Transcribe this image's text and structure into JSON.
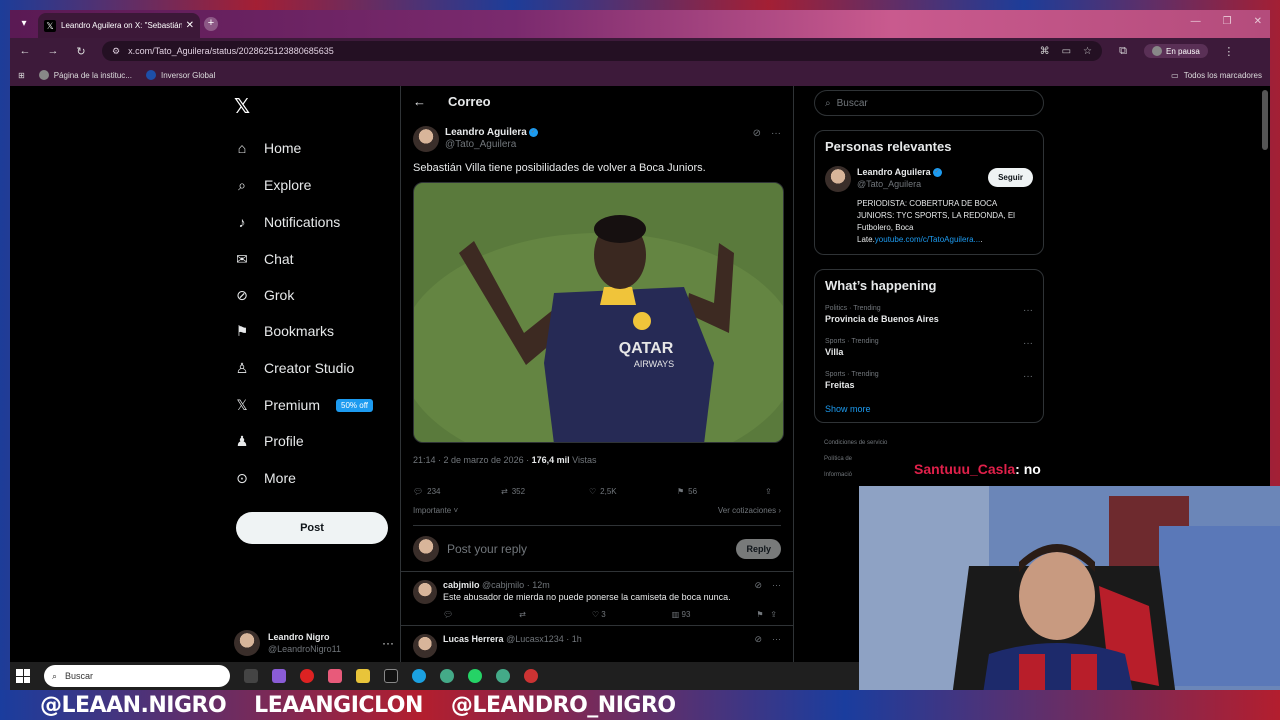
{
  "browser": {
    "tab_title": "Leandro Aguilera on X: \"Sebastián",
    "url": "x.com/Tato_Aguilera/status/2028625123880685635",
    "profile_status": "En pausa",
    "bookmarks": [
      "Página de la instituc...",
      "Inversor Global"
    ],
    "all_bookmarks": "Todos los marcadores"
  },
  "sidebar": {
    "items": [
      {
        "label": "Home"
      },
      {
        "label": "Explore"
      },
      {
        "label": "Notifications"
      },
      {
        "label": "Chat"
      },
      {
        "label": "Grok"
      },
      {
        "label": "Bookmarks"
      },
      {
        "label": "Creator Studio"
      },
      {
        "label": "Premium",
        "badge": "50% off"
      },
      {
        "label": "Profile"
      },
      {
        "label": "More"
      }
    ],
    "post_label": "Post",
    "account": {
      "name": "Leandro Nigro",
      "handle": "@LeandroNigro11"
    }
  },
  "main": {
    "header": "Correo",
    "tweet": {
      "name": "Leandro Aguilera",
      "handle": "@Tato_Aguilera",
      "text": "Sebastián Villa tiene posibilidades de volver a Boca Juniors.",
      "timestamp": "21:14 · 2 de marzo de 2026 ·",
      "views": "176,4 mil",
      "views_label": "Vistas",
      "replies": "234",
      "reposts": "352",
      "likes": "2,5K",
      "bookmarks": "56",
      "sort": "Importante",
      "quotes": "Ver cotizaciones"
    },
    "reply_placeholder": "Post your reply",
    "reply_button": "Reply",
    "replies": [
      {
        "name": "cabjmilo",
        "handle": "@cabjmilo",
        "time": "· 12m",
        "text": "Este abusador de mierda no puede ponerse la camiseta de boca nunca.",
        "likes": "3",
        "views": "93"
      },
      {
        "name": "Lucas Herrera",
        "handle": "@Lucasx1234",
        "time": "· 1h",
        "text": ""
      }
    ]
  },
  "right": {
    "search_placeholder": "Buscar",
    "relevant_title": "Personas relevantes",
    "relevant": {
      "name": "Leandro Aguilera",
      "handle": "@Tato_Aguilera",
      "follow": "Seguir",
      "bio_prefix": "PERIODISTA: COBERTURA DE BOCA JUNIORS: TYC SPORTS, LA REDONDA, El Futbolero, Boca Late.",
      "bio_link": "youtube.com/c/TatoAguilera...",
      "bio_suffix": "."
    },
    "happening_title": "What’s happening",
    "trends": [
      {
        "category": "Politics · Trending",
        "title": "Provincia de Buenos Aires"
      },
      {
        "category": "Sports · Trending",
        "title": "Villa"
      },
      {
        "category": "Sports · Trending",
        "title": "Freitas"
      }
    ],
    "show_more": "Show more",
    "footer": [
      "Condiciones de servicio",
      "Política de",
      "Informació"
    ]
  },
  "taskbar": {
    "search": "Buscar"
  },
  "stream": {
    "chat_user": "Santuuu_Casla",
    "chat_msg": ": no",
    "banner": [
      "@LEAAN.NIGRO",
      "LEAANGICLON",
      "@LEANDRO_NIGRO"
    ]
  }
}
